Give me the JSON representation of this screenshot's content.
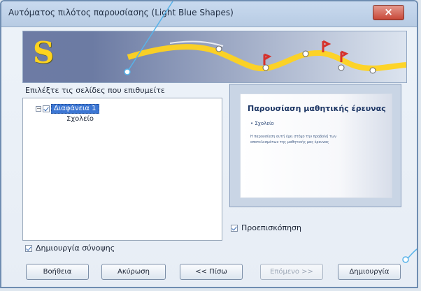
{
  "window": {
    "title": "Αυτόματος πιλότος παρουσίασης (Light Blue Shapes)",
    "close_symbol": "×"
  },
  "banner": {
    "logo_letter": "S"
  },
  "left_panel": {
    "label": "Επιλέξτε τις σελίδες που επιθυμείτε",
    "tree": {
      "expander_symbol": "−",
      "root_label": "Διαφάνεια 1",
      "child_label": "Σχολείο"
    },
    "summary_checkbox_label": "Δημιουργία σύνοψης"
  },
  "preview": {
    "slide_title": "Παρουσίαση μαθητικής έρευνας",
    "bullet": "• Σχολείο",
    "body_text": "Η παρουσίαση αυτή έχει στόχο την προβολή των αποτελεσμάτων της μαθητικής μας έρευνας",
    "preview_checkbox_label": "Προεπισκόπηση"
  },
  "buttons": {
    "help": "Βοήθεια",
    "cancel": "Ακύρωση",
    "back": "<< Πίσω",
    "next": "Επόμενο >>",
    "create": "Δημιουργία"
  },
  "colors": {
    "accent": "#3c76d3",
    "annotation": "#57b3ea",
    "banner_yellow": "#ffd31e",
    "banner_red": "#d6312c"
  }
}
